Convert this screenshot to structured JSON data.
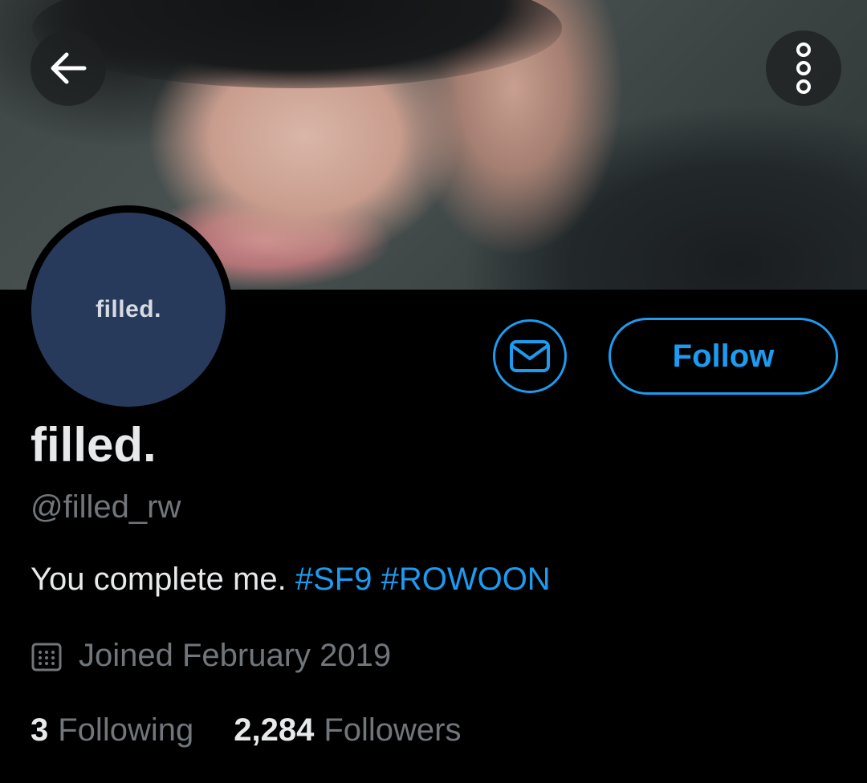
{
  "banner": {
    "description_icon": "banner-photo"
  },
  "nav": {
    "back_icon": "arrow-left-icon",
    "more_icon": "more-vertical-icon"
  },
  "avatar": {
    "text": "filled."
  },
  "actions": {
    "message_icon": "envelope-icon",
    "follow_label": "Follow"
  },
  "profile": {
    "display_name": "filled.",
    "handle": "@filled_rw",
    "bio_text": "You complete me.",
    "bio_tags": [
      "#SF9",
      "#ROWOON"
    ],
    "joined": "Joined February 2019",
    "following_count": "3",
    "following_label": "Following",
    "followers_count": "2,284",
    "followers_label": "Followers"
  },
  "colors": {
    "accent": "#1d9bf0",
    "background": "#000000",
    "muted_text": "#71767b",
    "avatar_bg": "#283a5c"
  }
}
